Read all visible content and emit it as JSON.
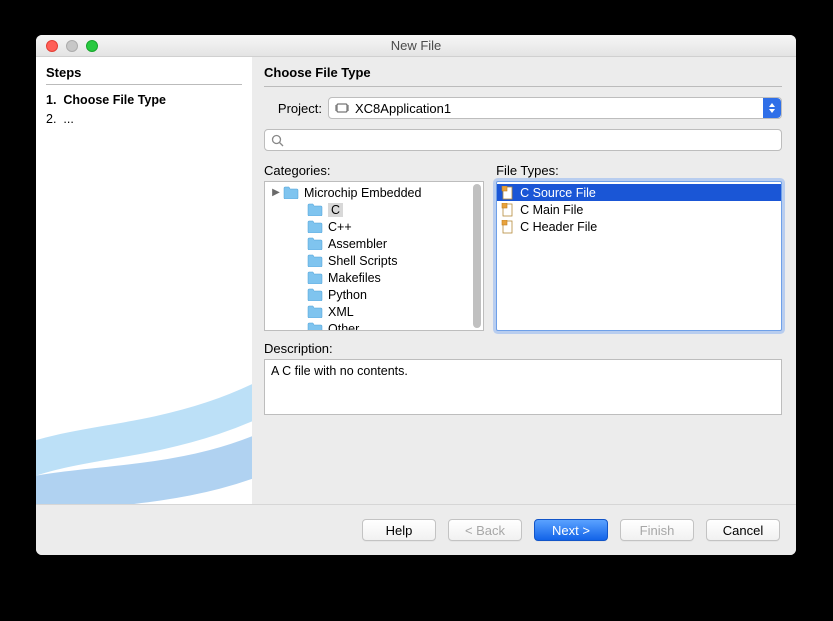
{
  "window": {
    "title": "New File"
  },
  "sidebar": {
    "heading": "Steps",
    "steps": [
      {
        "num": "1.",
        "label": "Choose File Type",
        "current": true
      },
      {
        "num": "2.",
        "label": "...",
        "current": false
      }
    ]
  },
  "main": {
    "heading": "Choose File Type",
    "project_label": "Project:",
    "project_value": "XC8Application1",
    "filter_value": "",
    "categories_label": "Categories:",
    "filetypes_label": "File Types:",
    "categories": [
      {
        "label": "Microchip Embedded",
        "expanded": true,
        "level": 0
      },
      {
        "label": "C",
        "level": 1,
        "selected": true
      },
      {
        "label": "C++",
        "level": 1
      },
      {
        "label": "Assembler",
        "level": 1
      },
      {
        "label": "Shell Scripts",
        "level": 1
      },
      {
        "label": "Makefiles",
        "level": 1
      },
      {
        "label": "Python",
        "level": 1
      },
      {
        "label": "XML",
        "level": 1
      },
      {
        "label": "Other",
        "level": 1
      }
    ],
    "filetypes": [
      {
        "label": "C Source File",
        "selected": true
      },
      {
        "label": "C Main File"
      },
      {
        "label": "C Header File"
      }
    ],
    "description_label": "Description:",
    "description_text": "A C file with no contents."
  },
  "footer": {
    "help": "Help",
    "back": "< Back",
    "next": "Next >",
    "finish": "Finish",
    "cancel": "Cancel"
  }
}
